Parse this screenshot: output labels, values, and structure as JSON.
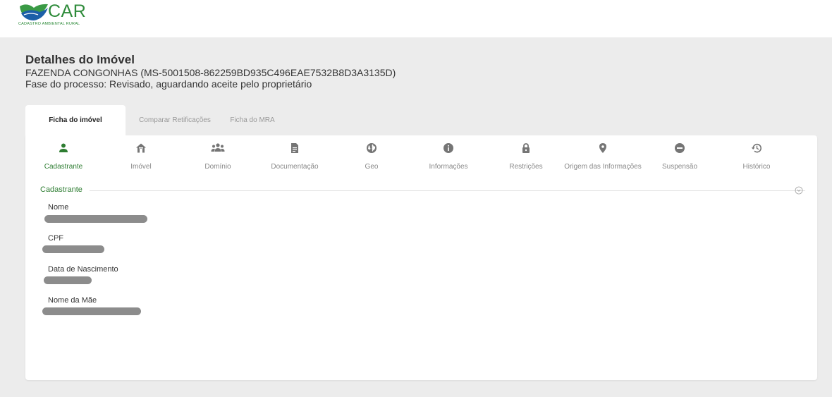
{
  "brand": {
    "name": "CAR",
    "subtitle": "CADASTRO AMBIENTAL RURAL"
  },
  "header": {
    "title": "Detalhes do Imóvel",
    "property": "FAZENDA CONGONHAS (MS-5001508-862259BD935C496EAE7532B8D3A3135D)",
    "phase": "Fase do processo: Revisado, aguardando aceite pelo proprietário"
  },
  "tabs": [
    {
      "label": "Ficha do imóvel",
      "active": true
    },
    {
      "label": "Comparar Retificações",
      "active": false
    },
    {
      "label": "Ficha do MRA",
      "active": false
    }
  ],
  "nav": [
    {
      "label": "Cadastrante",
      "icon": "person-icon",
      "active": true
    },
    {
      "label": "Imóvel",
      "icon": "home-icon",
      "active": false
    },
    {
      "label": "Domínio",
      "icon": "people-icon",
      "active": false
    },
    {
      "label": "Documentação",
      "icon": "document-icon",
      "active": false
    },
    {
      "label": "Geo",
      "icon": "globe-icon",
      "active": false
    },
    {
      "label": "Informações",
      "icon": "info-icon",
      "active": false
    },
    {
      "label": "Restrições",
      "icon": "lock-icon",
      "active": false
    },
    {
      "label": "Origem das Informações",
      "icon": "location-pin-icon",
      "active": false
    },
    {
      "label": "Suspensão",
      "icon": "minus-circle-icon",
      "active": false
    },
    {
      "label": "Histórico",
      "icon": "history-icon",
      "active": false
    }
  ],
  "section": {
    "title": "Cadastrante"
  },
  "fields": [
    {
      "label": "Nome",
      "value_redacted": true
    },
    {
      "label": "CPF",
      "value_redacted": true
    },
    {
      "label": "Data de Nascimento",
      "value_redacted": true
    },
    {
      "label": "Nome da Mãe",
      "value_redacted": true
    }
  ],
  "colors": {
    "accent": "#2e7d32",
    "brand": "#2e8b3a",
    "icon": "#757575",
    "background": "#ececec"
  }
}
